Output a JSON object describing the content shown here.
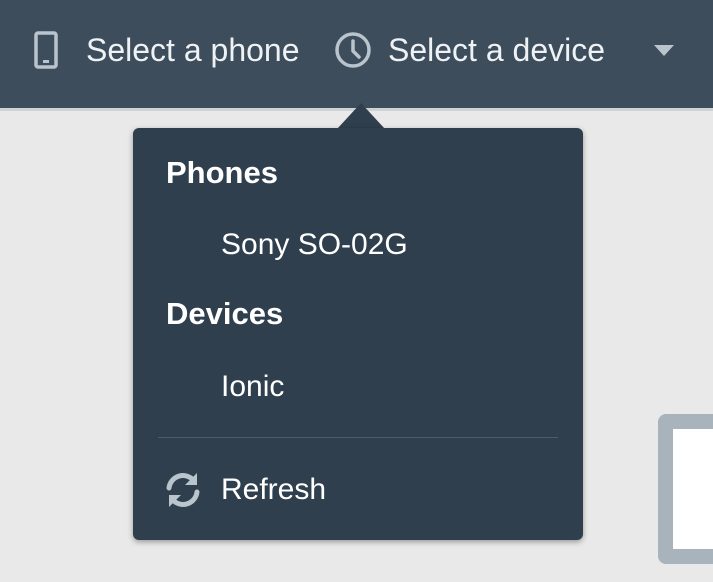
{
  "header": {
    "phone_select_label": "Select a phone",
    "device_select_label": "Select a device",
    "icons": {
      "phone": "phone-icon",
      "device": "clock-icon",
      "dropdown": "chevron-down-icon"
    }
  },
  "dropdown": {
    "groups": [
      {
        "title": "Phones",
        "items": [
          "Sony SO-02G"
        ]
      },
      {
        "title": "Devices",
        "items": [
          "Ionic"
        ]
      }
    ],
    "refresh_label": "Refresh",
    "refresh_icon": "refresh-icon"
  },
  "colors": {
    "topbar": "#3d4d5c",
    "popover": "#2f3f4d",
    "background": "#e9e9e9",
    "text": "#ffffff",
    "icon": "#b9c4cc"
  }
}
